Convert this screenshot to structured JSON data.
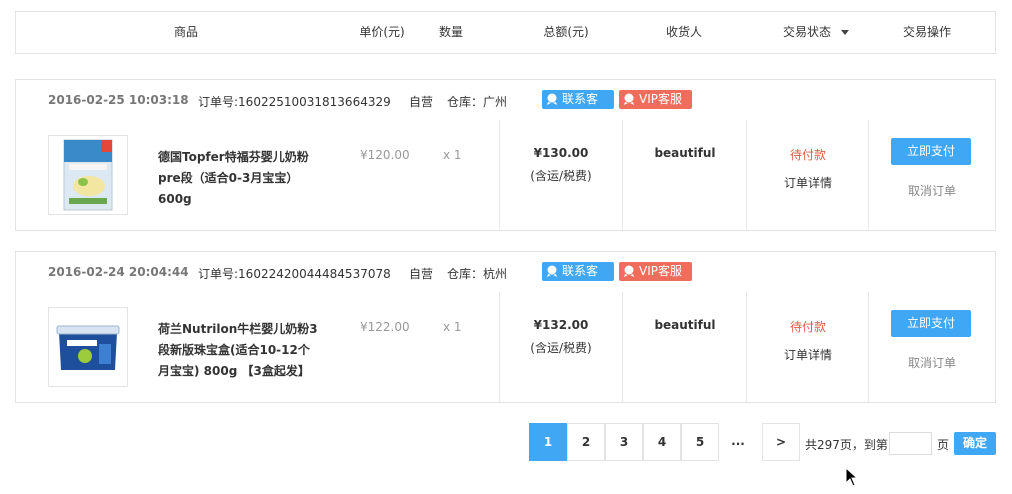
{
  "header": {
    "columns": {
      "product": "商品",
      "unit_price": "单价(元)",
      "quantity": "数量",
      "total": "总额(元)",
      "receiver": "收货人",
      "status": "交易状态",
      "actions": "交易操作"
    }
  },
  "orders": [
    {
      "time": "2016-02-25 10:03:18",
      "order_no": "订单号:16022510031813664329",
      "self_run": "自营",
      "warehouse": "仓库：广州",
      "badge_service": "联系客服",
      "badge_vip": "VIP客服",
      "product_name": "德国Topfer特福芬婴儿奶粉pre段（适合0-3月宝宝）600g",
      "price": "¥120.00",
      "qty": "x 1",
      "total": "¥130.00",
      "total_note": "(含运/税费)",
      "receiver": "beautiful",
      "status": "待付款",
      "detail": "订单详情",
      "pay": "立即支付",
      "cancel": "取消订单"
    },
    {
      "time": "2016-02-24 20:04:44",
      "order_no": "订单号:16022420044484537078",
      "self_run": "自营",
      "warehouse": "仓库：杭州",
      "badge_service": "联系客服",
      "badge_vip": "VIP客服",
      "product_name": "荷兰Nutrilon牛栏婴儿奶粉3段新版珠宝盒(适合10-12个月宝宝) 800g 【3盒起发】",
      "price": "¥122.00",
      "qty": "x 1",
      "total": "¥132.00",
      "total_note": "(含运/税费)",
      "receiver": "beautiful",
      "status": "待付款",
      "detail": "订单详情",
      "pay": "立即支付",
      "cancel": "取消订单"
    }
  ],
  "pagination": {
    "pages": [
      "1",
      "2",
      "3",
      "4",
      "5"
    ],
    "current": "1",
    "ellipsis": "...",
    "next": ">",
    "total_text": "共297页，到第",
    "page_suffix": "页",
    "confirm": "确定"
  },
  "colors": {
    "accent": "#3fa7f3",
    "vip": "#f06d5b",
    "status_pending": "#e05a45"
  }
}
